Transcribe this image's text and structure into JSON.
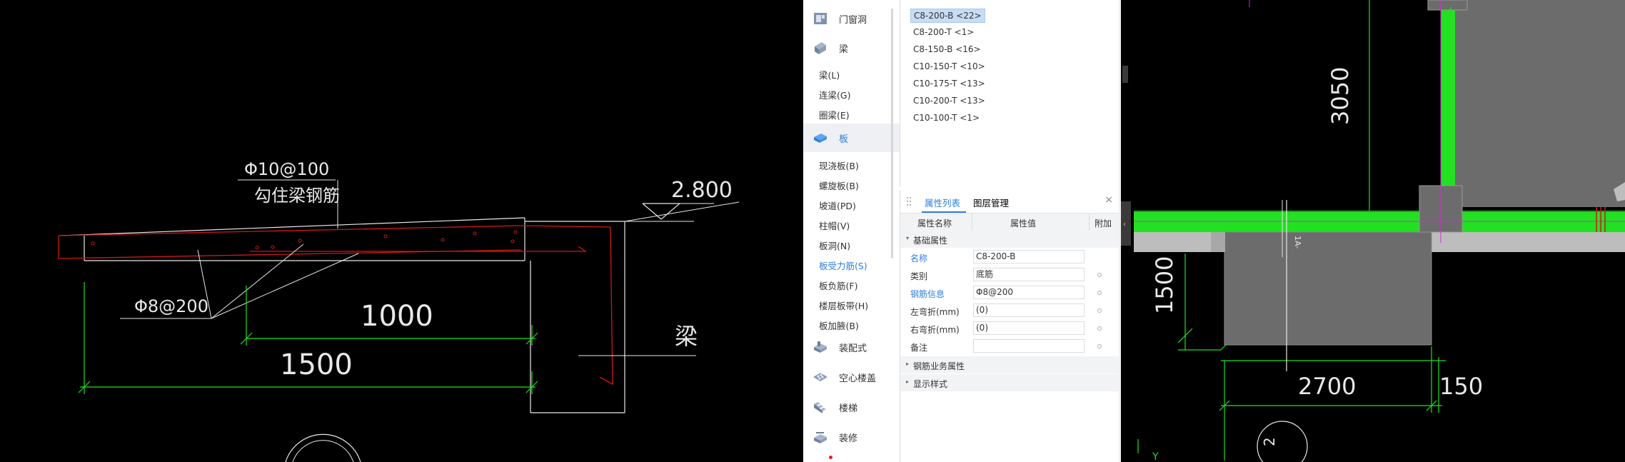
{
  "cad_left": {
    "rebar_top_label": "Φ10@100",
    "rebar_top_desc": "勾住梁钢筋",
    "rebar_bottom_label": "Φ8@200",
    "elevation": "2.800",
    "dim_inner": "1000",
    "dim_outer": "1500",
    "beam_label": "梁"
  },
  "nav": {
    "categories": [
      {
        "label": "门窗洞",
        "icon": "door-window-icon"
      },
      {
        "label": "梁",
        "icon": "beam-icon"
      },
      {
        "label": "板",
        "icon": "slab-icon"
      },
      {
        "label": "装配式",
        "icon": "prefab-icon"
      },
      {
        "label": "空心楼盖",
        "icon": "hollow-floor-icon"
      },
      {
        "label": "楼梯",
        "icon": "stairs-icon"
      },
      {
        "label": "装修",
        "icon": "decoration-icon"
      }
    ],
    "beam_items": [
      "梁(L)",
      "连梁(G)",
      "圈梁(E)"
    ],
    "slab_items": [
      "现浇板(B)",
      "螺旋板(B)",
      "坡道(PD)",
      "柱帽(V)",
      "板洞(N)",
      "板受力筋(S)",
      "板负筋(F)",
      "楼层板带(H)",
      "板加腋(B)"
    ]
  },
  "rebar_list": [
    "C8-200-B <22>",
    "C8-200-T <1>",
    "C8-150-B <16>",
    "C10-150-T <10>",
    "C10-175-T <13>",
    "C10-200-T <13>",
    "C10-100-T <1>"
  ],
  "props": {
    "tabs": [
      "属性列表",
      "图层管理"
    ],
    "col_name": "属性名称",
    "col_value": "属性值",
    "col_extra": "附加",
    "group_basic": "基础属性",
    "rows": [
      {
        "name": "名称",
        "value": "C8-200-B"
      },
      {
        "name": "类别",
        "value": "底筋"
      },
      {
        "name": "钢筋信息",
        "value": "Φ8@200"
      },
      {
        "name": "左弯折(mm)",
        "value": "(0)"
      },
      {
        "name": "右弯折(mm)",
        "value": "(0)"
      },
      {
        "name": "备注",
        "value": ""
      }
    ],
    "group_business": "钢筋业务属性",
    "group_display": "显示样式",
    "close": "×"
  },
  "cad_right": {
    "dim_vertical_top": "3050",
    "dim_vertical_left": "1500",
    "dim_bottom": "2700",
    "dim_bottom_right": "150",
    "axis_y": "Y"
  },
  "colors": {
    "accent": "#2e7de0",
    "cad_green": "#22e022",
    "rebar_red": "#d01818"
  }
}
